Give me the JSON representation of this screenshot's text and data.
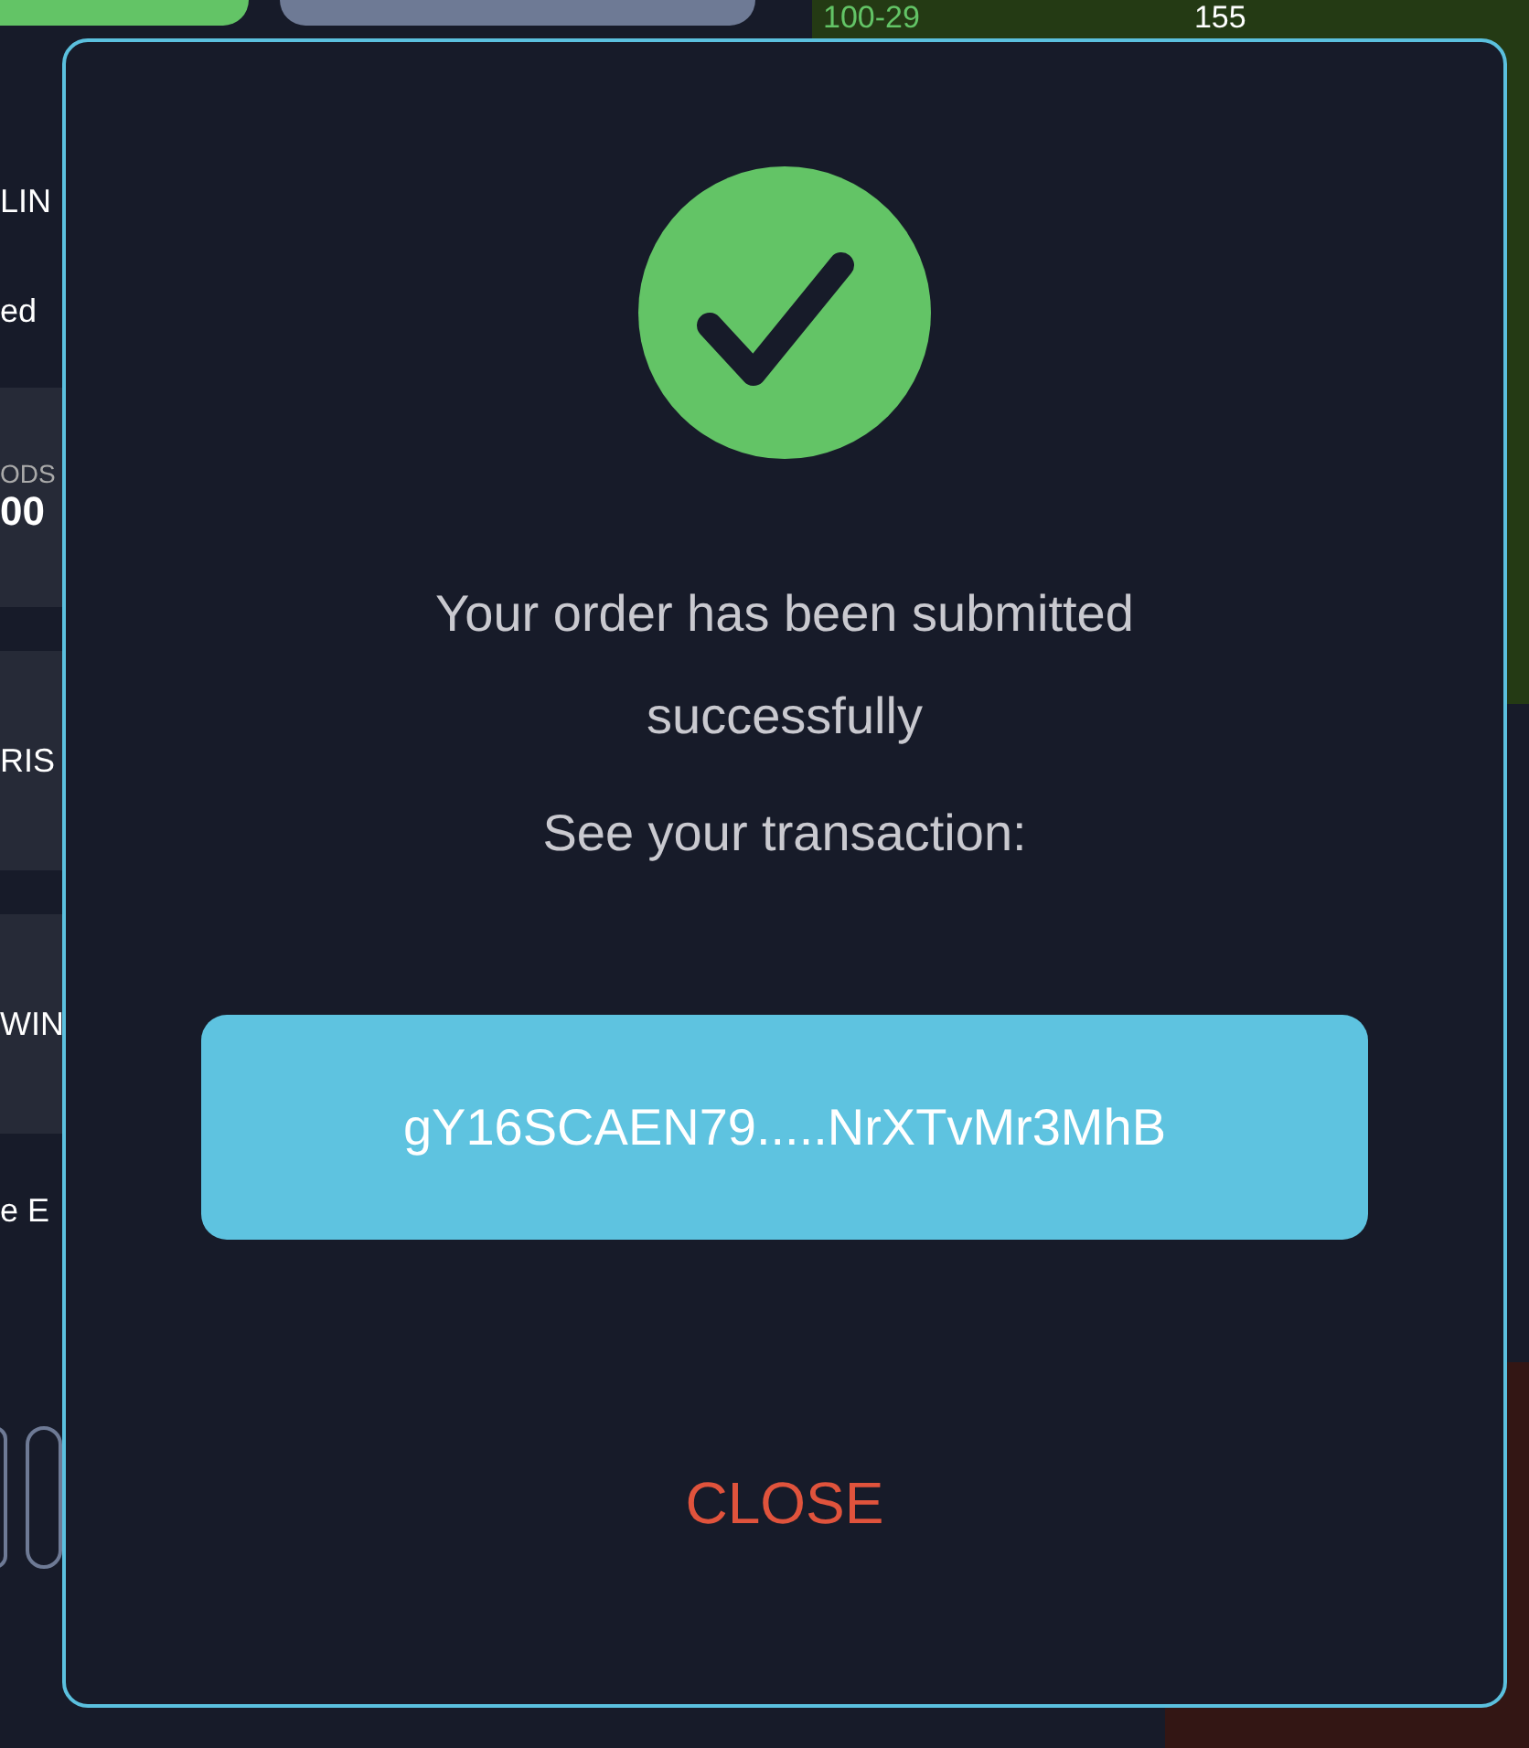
{
  "background": {
    "market": {
      "range": "100-29",
      "count": "155"
    },
    "left_items": [
      {
        "kind": "label",
        "text": "LIN"
      },
      {
        "kind": "label",
        "text": "ed"
      },
      {
        "kind": "stat",
        "caption": "ODS",
        "value": "00"
      },
      {
        "kind": "card",
        "text": "RIS"
      },
      {
        "kind": "card",
        "text": "WIN"
      },
      {
        "kind": "label",
        "text": "e E"
      }
    ]
  },
  "dialog": {
    "message": "Your order has been submitted successfully",
    "prompt": "See your transaction:",
    "transaction_id": "gY16SCAEN79.....NrXTvMr3MhB",
    "close_label": "CLOSE"
  }
}
